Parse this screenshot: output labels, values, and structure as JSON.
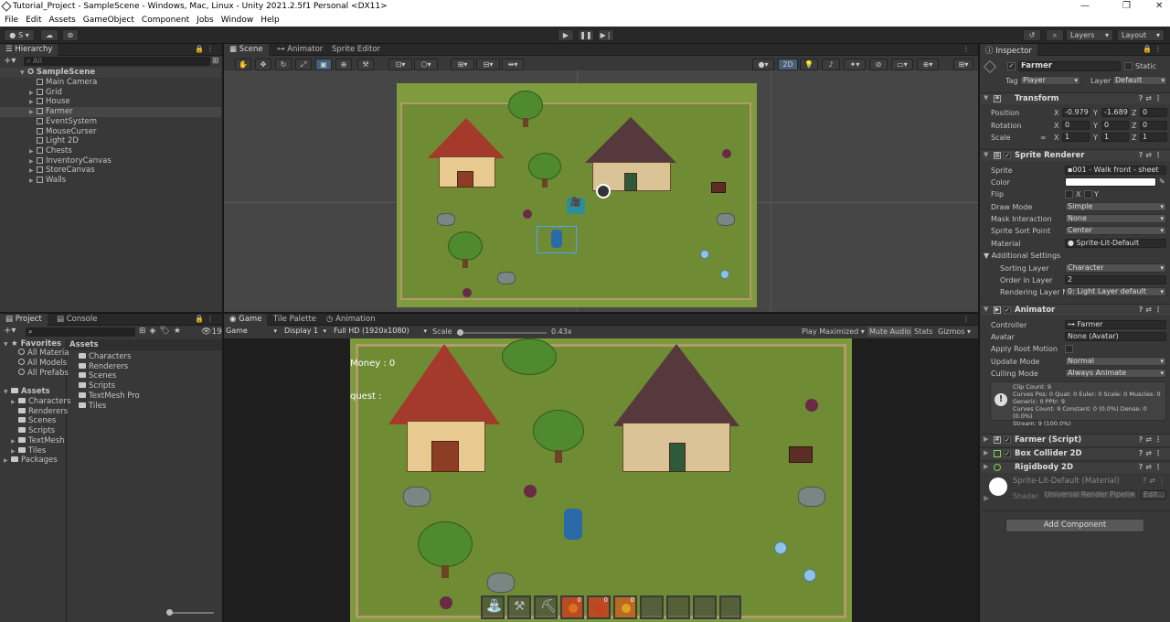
{
  "window": {
    "title": "Tutorial_Project - SampleScene - Windows, Mac, Linux - Unity 2021.2.5f1 Personal <DX11>",
    "controls": [
      "—",
      "❐",
      "✕"
    ]
  },
  "menu": [
    "File",
    "Edit",
    "Assets",
    "GameObject",
    "Component",
    "Jobs",
    "Window",
    "Help"
  ],
  "toolbar": {
    "account": "S",
    "layers": "Layers",
    "layout": "Layout"
  },
  "hierarchy": {
    "tab": "Hierarchy",
    "search_placeholder": "All",
    "scene": "SampleScene",
    "items": [
      "Main Camera",
      "Grid",
      "House",
      "Farmer",
      "EventSystem",
      "MouseCurser",
      "Light 2D",
      "Chests",
      "InventoryCanvas",
      "StoreCanvas",
      "Walls"
    ]
  },
  "scene_tabs": [
    "Scene",
    "Animator",
    "Sprite Editor"
  ],
  "scene_toolbar": {
    "mode2d": "2D"
  },
  "bottom_tabs": [
    "Project",
    "Console"
  ],
  "project": {
    "count": "19",
    "favorites": "Favorites",
    "fav_items": [
      "All Materia",
      "All Models",
      "All Prefabs"
    ],
    "assets": "Assets",
    "asset_items": [
      "Characters",
      "Renderers",
      "Scenes",
      "Scripts",
      "TextMesh",
      "Tiles"
    ],
    "packages": "Packages",
    "grid_header": "Assets",
    "grid_items": [
      "Characters",
      "Renderers",
      "Scenes",
      "Scripts",
      "TextMesh Pro",
      "Tiles"
    ]
  },
  "game_tabs": [
    "Game",
    "Tile Palette",
    "Animation"
  ],
  "game_toolbar": {
    "view": "Game",
    "display": "Display 1",
    "resolution": "Full HD (1920x1080)",
    "scale_label": "Scale",
    "scale_value": "0.43x",
    "play": "Play Maximized",
    "mute": "Mute Audio",
    "stats": "Stats",
    "gizmos": "Gizmos"
  },
  "game_hud": {
    "money": "Money : 0",
    "quest": "quest :"
  },
  "hotbar": {
    "counts": [
      "0",
      "0",
      "0"
    ]
  },
  "inspector": {
    "tab": "Inspector",
    "name": "Farmer",
    "static": "Static",
    "tag_label": "Tag",
    "tag": "Player",
    "layer_label": "Layer",
    "layer": "Default",
    "transform": {
      "title": "Transform",
      "rows": [
        {
          "label": "Position",
          "x": "-0.979",
          "y": "-1.689",
          "z": "0"
        },
        {
          "label": "Rotation",
          "x": "0",
          "y": "0",
          "z": "0"
        },
        {
          "label": "Scale",
          "x": "1",
          "y": "1",
          "z": "1"
        }
      ]
    },
    "sprite_renderer": {
      "title": "Sprite Renderer",
      "sprite_label": "Sprite",
      "sprite": "001 - Walk front - sheet",
      "color_label": "Color",
      "flip_label": "Flip",
      "flip_x": "X",
      "flip_y": "Y",
      "draw_mode_label": "Draw Mode",
      "draw_mode": "Simple",
      "mask_label": "Mask Interaction",
      "mask": "None",
      "sort_point_label": "Sprite Sort Point",
      "sort_point": "Center",
      "material_label": "Material",
      "material": "Sprite-Lit-Default",
      "additional": "Additional Settings",
      "sorting_layer_label": "Sorting Layer",
      "sorting_layer": "Character",
      "order_label": "Order in Layer",
      "order": "2",
      "rendering_layer_label": "Rendering Layer M",
      "rendering_layer": "0: Light Layer default"
    },
    "animator": {
      "title": "Animator",
      "controller_label": "Controller",
      "controller": "Farmer",
      "avatar_label": "Avatar",
      "avatar": "None (Avatar)",
      "root_motion_label": "Apply Root Motion",
      "update_mode_label": "Update Mode",
      "update_mode": "Normal",
      "culling_label": "Culling Mode",
      "culling": "Always Animate",
      "info": [
        "Clip Count: 9",
        "Curves Pos: 0 Quat: 0 Euler: 0 Scale: 0 Muscles: 0",
        "Generic: 0 PPtr: 9",
        "Curves Count: 9 Constant: 0 (0.0%) Dense: 0 (0.0%)",
        "Stream: 9 (100.0%)"
      ]
    },
    "farmer_script": "Farmer (Script)",
    "box_collider": "Box Collider 2D",
    "rigidbody": "Rigidbody 2D",
    "material_block": {
      "name": "Sprite-Lit-Default (Material)",
      "shader_label": "Shader",
      "shader": "Universal Render Pipelin",
      "edit": "Edit..."
    },
    "add_component": "Add Component"
  }
}
